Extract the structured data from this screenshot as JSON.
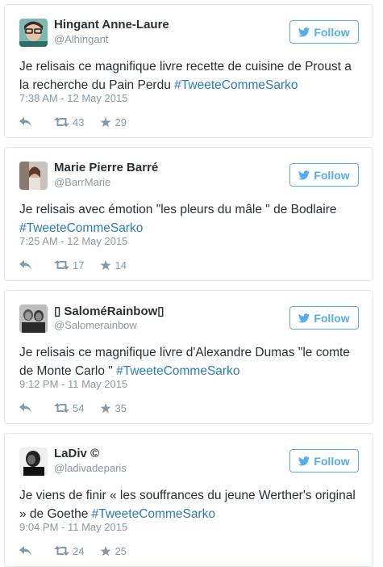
{
  "tweets": [
    {
      "name": "Hingant Anne-Laure",
      "handle": "@Alhingant",
      "follow_label": "Follow",
      "text": "Je relisais ce magnifique livre recette de cuisine de Proust a la recherche du Pain Perdu ",
      "hashtag": "#TweeteCommeSarko",
      "time": "7:38 AM - 12 May 2015",
      "retweets": "43",
      "likes": "29"
    },
    {
      "name": "Marie Pierre Barré",
      "handle": "@BarrMarie",
      "follow_label": "Follow",
      "text": "Je relisais avec émotion \"les pleurs du mâle \" de Bodlaire ",
      "hashtag": "#TweeteCommeSarko",
      "time": "7:25 AM - 12 May 2015",
      "retweets": "17",
      "likes": "14"
    },
    {
      "name": "▯ SaloméRainbow▯",
      "handle": "@Salomerainbow",
      "follow_label": "Follow",
      "text": "Je relisais ce magnifique livre d'Alexandre Dumas \"le comte de Monte Carlo \" ",
      "hashtag": "#TweeteCommeSarko",
      "time": "9:12 PM - 11 May 2015",
      "retweets": "54",
      "likes": "35"
    },
    {
      "name": "LaDiv ©",
      "handle": "@ladivadeparis",
      "follow_label": "Follow",
      "text": "Je viens de finir « les souffrances du jeune Werther's original » de Goethe ",
      "hashtag": "#TweeteCommeSarko",
      "time": "9:04 PM - 11 May 2015",
      "retweets": "24",
      "likes": "25"
    }
  ],
  "colors": {
    "accent": "#55acee",
    "hashtag": "#2b7bb9",
    "muted": "#8899a6",
    "border": "#e1e8ed"
  }
}
